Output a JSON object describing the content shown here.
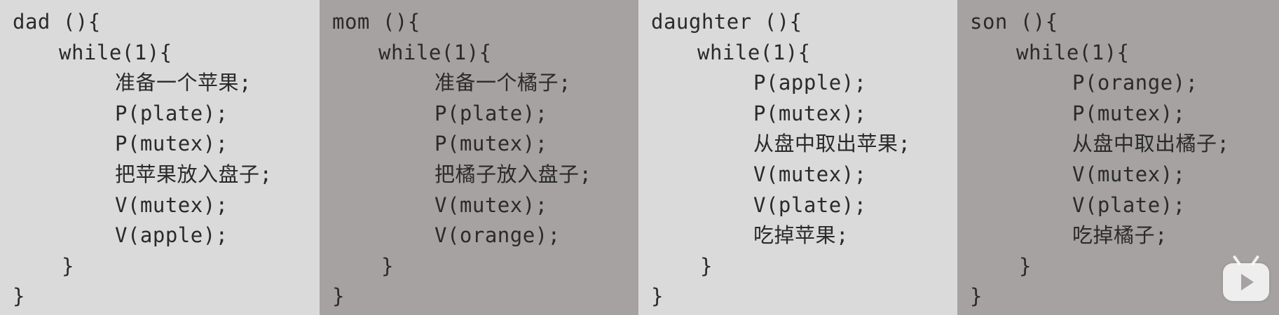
{
  "panels": [
    {
      "lines": [
        "dad (){",
        "while(1){",
        "准备一个苹果;",
        "P(plate);",
        "P(mutex);",
        "把苹果放入盘子;",
        "V(mutex);",
        "V(apple);",
        "}",
        "}"
      ]
    },
    {
      "lines": [
        "mom (){",
        "while(1){",
        "准备一个橘子;",
        "P(plate);",
        "P(mutex);",
        "把橘子放入盘子;",
        "V(mutex);",
        "V(orange);",
        "}",
        "}"
      ]
    },
    {
      "lines": [
        "daughter (){",
        "while(1){",
        "P(apple);",
        "P(mutex);",
        "从盘中取出苹果;",
        "V(mutex);",
        "V(plate);",
        "吃掉苹果;",
        "}",
        "}"
      ]
    },
    {
      "lines": [
        "son (){",
        "while(1){",
        "P(orange);",
        "P(mutex);",
        "从盘中取出橘子;",
        "V(mutex);",
        "V(plate);",
        "吃掉橘子;",
        "}",
        "}"
      ]
    }
  ],
  "colors": {
    "light_panel": "#dadada",
    "dark_panel": "#a6a2a2",
    "text": "#2a2a2a"
  },
  "icons": {
    "player_badge": "play-icon"
  }
}
